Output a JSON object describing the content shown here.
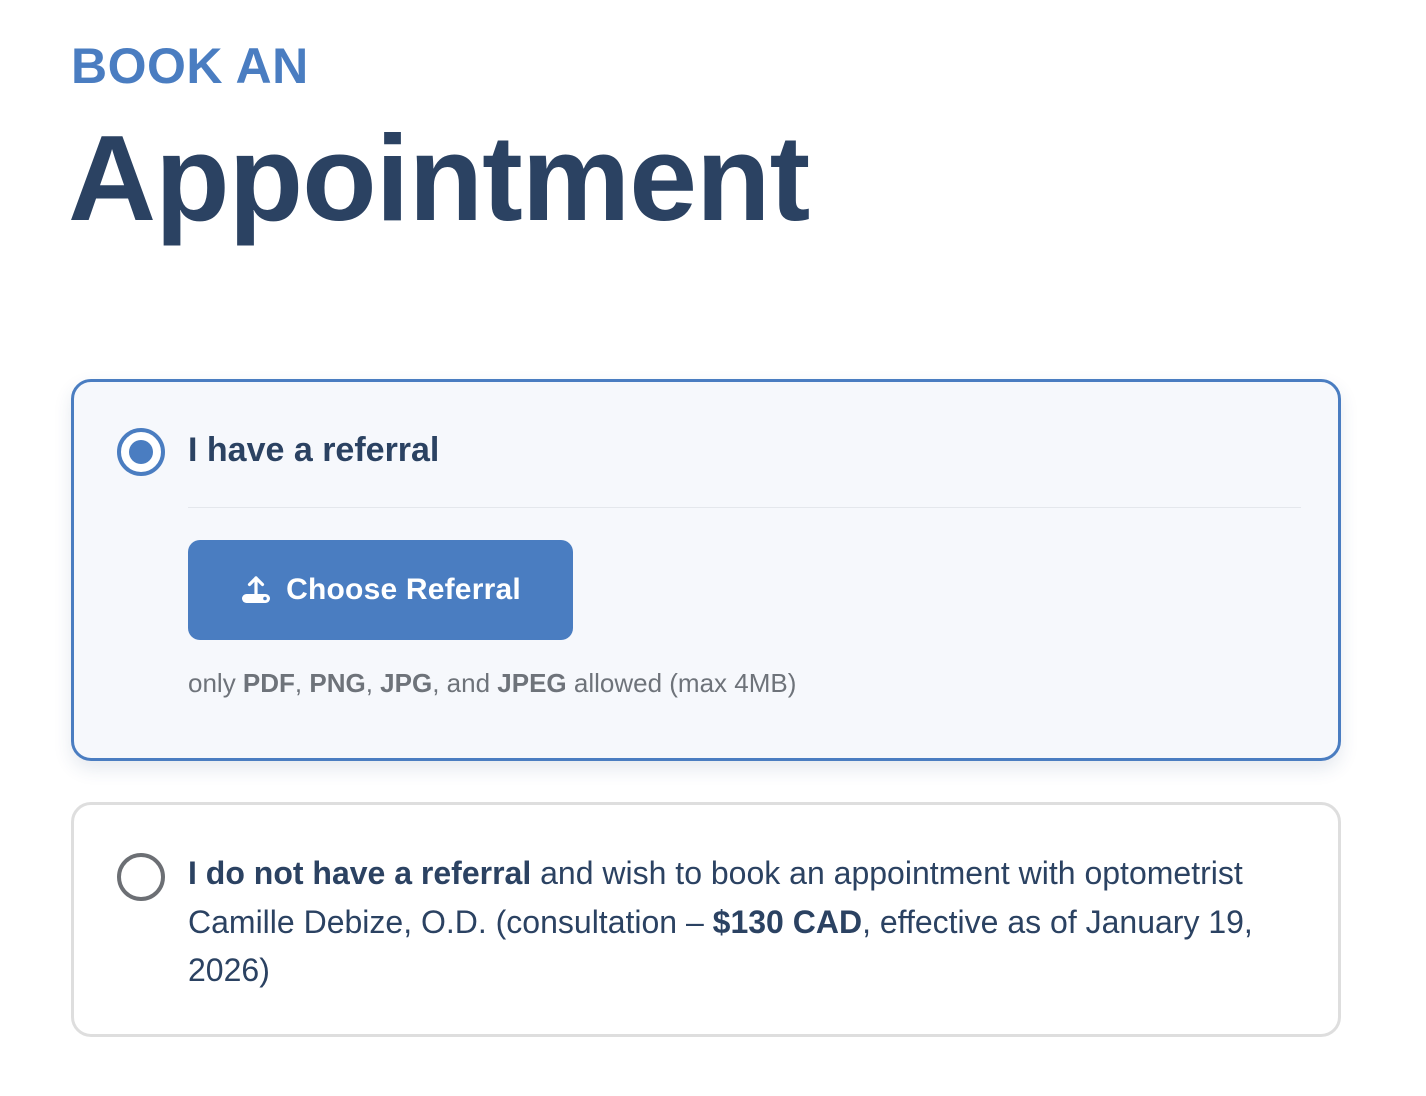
{
  "header": {
    "eyebrow": "BOOK AN",
    "title": "Appointment"
  },
  "options": {
    "referral": {
      "label": "I have a referral",
      "selected": true,
      "upload_button_label": "Choose Referral",
      "upload_icon": "upload-icon",
      "hint": {
        "prefix": "only ",
        "fmt1": "PDF",
        "sep1": ", ",
        "fmt2": "PNG",
        "sep2": ", ",
        "fmt3": "JPG",
        "sep3": ", and ",
        "fmt4": "JPEG",
        "suffix": " allowed (max 4MB)"
      }
    },
    "no_referral": {
      "selected": false,
      "label_bold": "I do not have a referral",
      "text_part1": " and wish to book an appointment with optometrist Camille Debize, O.D. (consultation – ",
      "price": "$130 CAD",
      "text_part2": ", effective as of January 19, 2026)"
    }
  },
  "colors": {
    "accent": "#4a7dc1",
    "heading": "#2b4262",
    "muted": "#6e737a",
    "selected_card_bg": "#f6f8fc",
    "unselected_border": "#dedede"
  }
}
